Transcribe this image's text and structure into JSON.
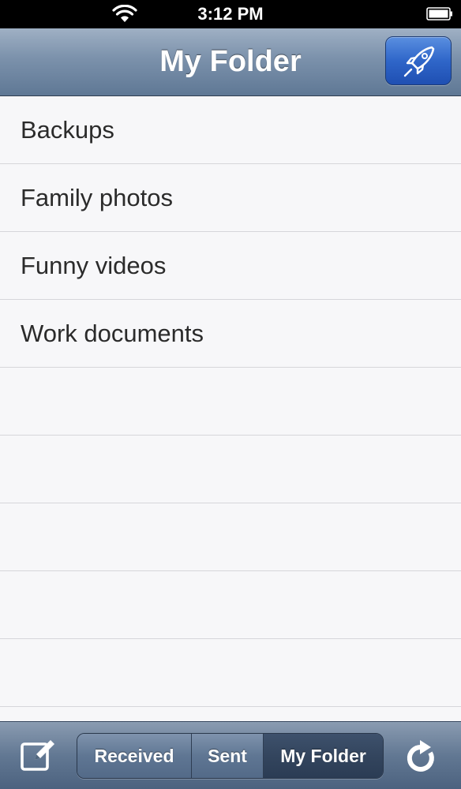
{
  "status_bar": {
    "time": "3:12 PM",
    "icons": [
      "wifi-icon",
      "battery-icon"
    ]
  },
  "nav_bar": {
    "title": "My Folder",
    "right_button_icon": "rocket-icon",
    "accent_color": "#2f66c9"
  },
  "folders": [
    {
      "label": "Backups"
    },
    {
      "label": "Family photos"
    },
    {
      "label": "Funny videos"
    },
    {
      "label": "Work documents"
    },
    {
      "label": ""
    },
    {
      "label": ""
    },
    {
      "label": ""
    },
    {
      "label": ""
    },
    {
      "label": ""
    }
  ],
  "toolbar": {
    "left_icon": "compose-icon",
    "right_icon": "refresh-icon",
    "segments": [
      {
        "label": "Received",
        "selected": false
      },
      {
        "label": "Sent",
        "selected": false
      },
      {
        "label": "My Folder",
        "selected": true
      }
    ]
  }
}
